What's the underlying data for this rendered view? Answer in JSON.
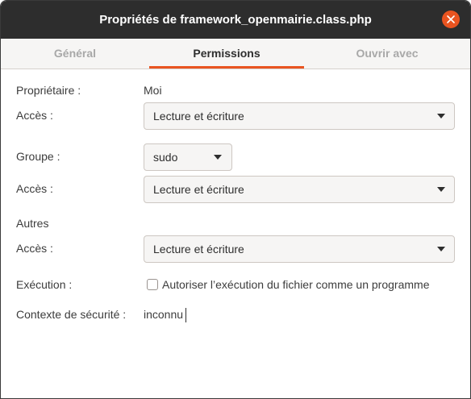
{
  "window": {
    "title": "Propriétés de framework_openmairie.class.php",
    "close_icon": "close-icon"
  },
  "tabs": [
    {
      "label": "Général",
      "active": false
    },
    {
      "label": "Permissions",
      "active": true
    },
    {
      "label": "Ouvrir avec",
      "active": false
    }
  ],
  "permissions": {
    "owner": {
      "label": "Propriétaire :",
      "value": "Moi"
    },
    "owner_access": {
      "label": "Accès :",
      "value": "Lecture et écriture"
    },
    "group": {
      "label": "Groupe :",
      "value": "sudo"
    },
    "group_access": {
      "label": "Accès :",
      "value": "Lecture et écriture"
    },
    "others": {
      "label": "Autres"
    },
    "others_access": {
      "label": "Accès :",
      "value": "Lecture et écriture"
    },
    "execution": {
      "label": "Exécution :",
      "checkbox_label": "Autoriser l’exécution du fichier comme un programme",
      "checked": false
    },
    "security_context": {
      "label": "Contexte de sécurité :",
      "value": "inconnu"
    }
  },
  "colors": {
    "accent": "#e95420",
    "titlebar": "#2d2d2d"
  }
}
